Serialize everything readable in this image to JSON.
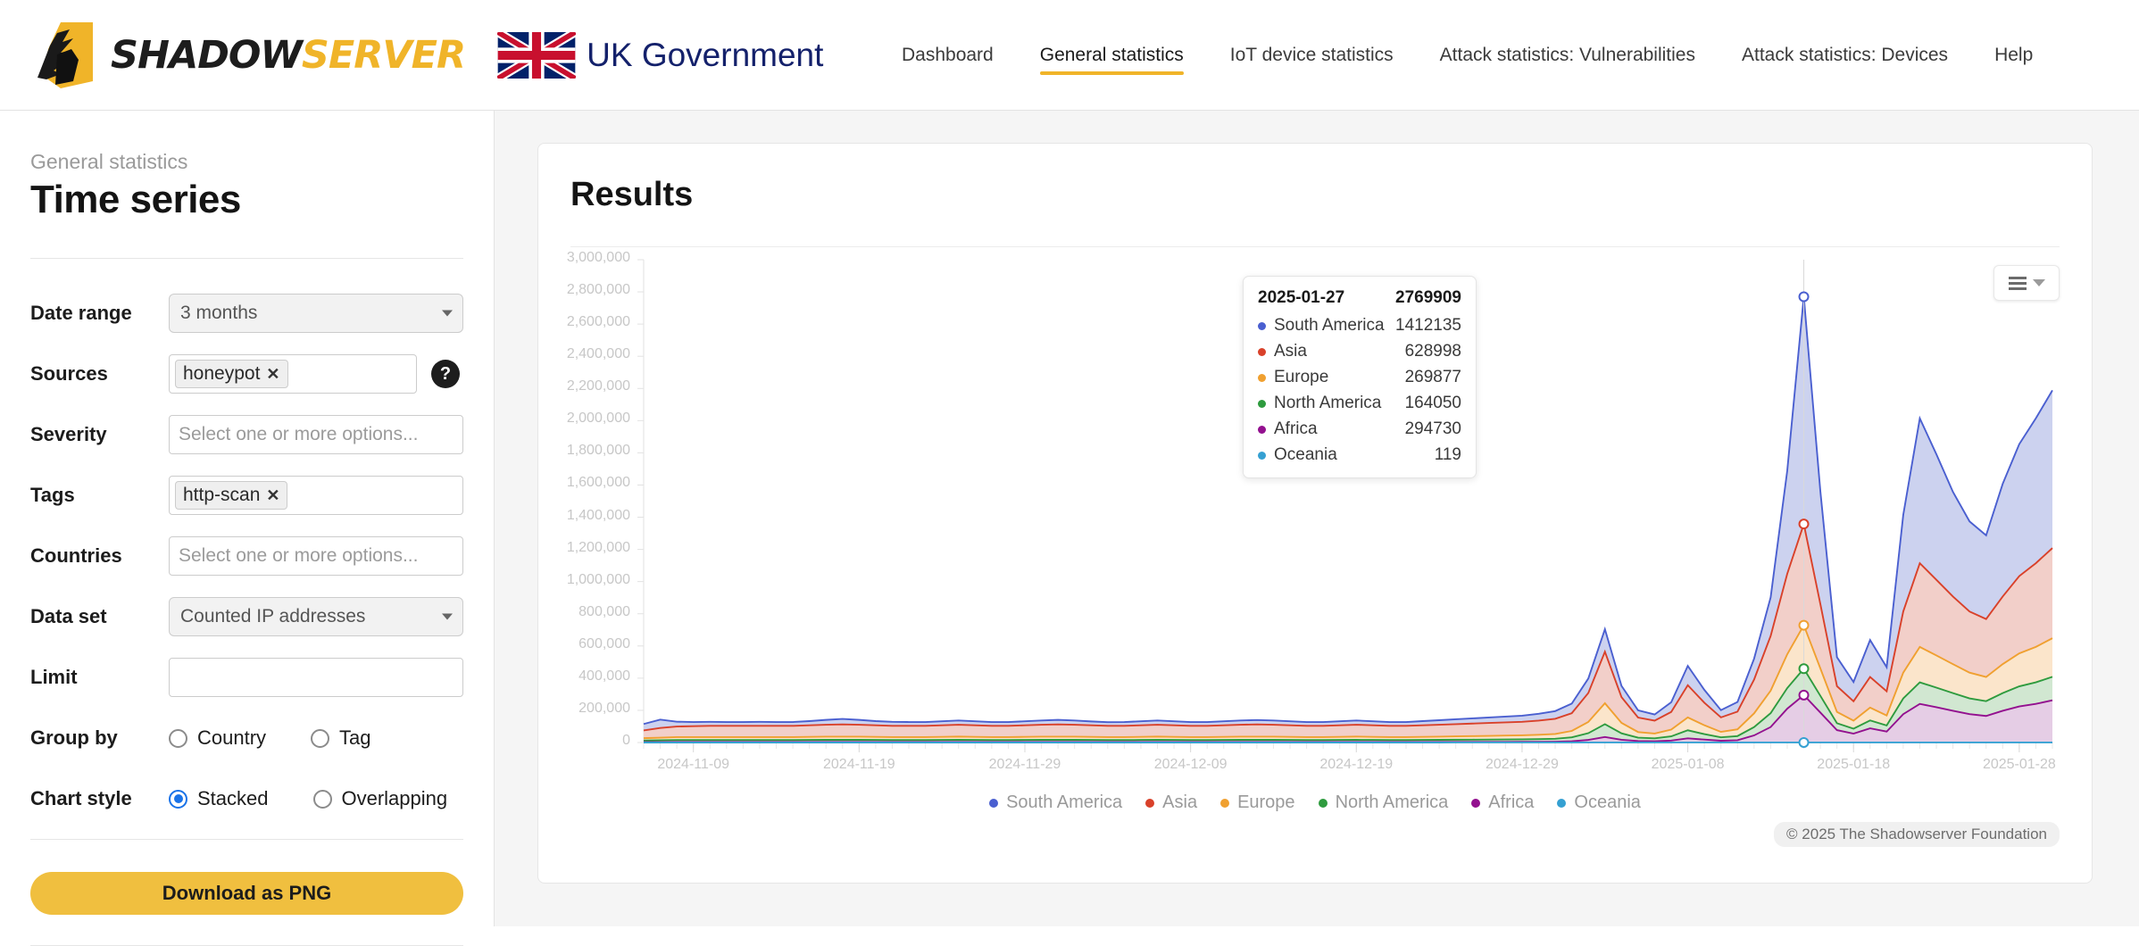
{
  "header": {
    "brand_a": "SHADOW",
    "brand_b": "SERVER",
    "gov_label": "UK Government",
    "nav": [
      {
        "label": "Dashboard",
        "active": false
      },
      {
        "label": "General statistics",
        "active": true
      },
      {
        "label": "IoT device statistics",
        "active": false
      },
      {
        "label": "Attack statistics: Vulnerabilities",
        "active": false
      },
      {
        "label": "Attack statistics: Devices",
        "active": false
      },
      {
        "label": "Help",
        "active": false
      }
    ]
  },
  "sidebar": {
    "kicker": "General statistics",
    "title": "Time series",
    "fields": {
      "date_range": {
        "label": "Date range",
        "value": "3 months"
      },
      "sources": {
        "label": "Sources",
        "tokens": [
          "honeypot"
        ],
        "help": "?"
      },
      "severity": {
        "label": "Severity",
        "placeholder": "Select one or more options..."
      },
      "tags": {
        "label": "Tags",
        "tokens": [
          "http-scan"
        ]
      },
      "countries": {
        "label": "Countries",
        "placeholder": "Select one or more options..."
      },
      "data_set": {
        "label": "Data set",
        "value": "Counted IP addresses"
      },
      "limit": {
        "label": "Limit",
        "value": ""
      },
      "group_by": {
        "label": "Group by",
        "options": [
          {
            "label": "Country",
            "checked": false
          },
          {
            "label": "Tag",
            "checked": false
          }
        ]
      },
      "chart_style": {
        "label": "Chart style",
        "options": [
          {
            "label": "Stacked",
            "checked": true
          },
          {
            "label": "Overlapping",
            "checked": false
          }
        ]
      }
    },
    "download_button": "Download as PNG"
  },
  "main": {
    "card_title": "Results",
    "menu_button": "chart-menu",
    "copyright": "© 2025 The Shadowserver Foundation"
  },
  "tooltip": {
    "date": "2025-01-27",
    "total": "2769909",
    "rows": [
      {
        "name": "South America",
        "value": "1412135",
        "color": "#4a5fd0"
      },
      {
        "name": "Asia",
        "value": "628998",
        "color": "#d9412a"
      },
      {
        "name": "Europe",
        "value": "269877",
        "color": "#f0a030"
      },
      {
        "name": "North America",
        "value": "164050",
        "color": "#2e9b3e"
      },
      {
        "name": "Africa",
        "value": "294730",
        "color": "#93108f"
      },
      {
        "name": "Oceania",
        "value": "119",
        "color": "#35a0d2"
      }
    ]
  },
  "chart_data": {
    "type": "area",
    "stacked": true,
    "title": "Results",
    "xlabel": "",
    "ylabel": "",
    "ylim": [
      0,
      3000000
    ],
    "grid": true,
    "legend_position": "bottom",
    "ytick_labels": [
      "3,000,000",
      "2,800,000",
      "2,600,000",
      "2,400,000",
      "2,200,000",
      "2,000,000",
      "1,800,000",
      "1,600,000",
      "1,400,000",
      "1,200,000",
      "1,000,000",
      "800,000",
      "600,000",
      "400,000",
      "200,000",
      "0"
    ],
    "ytick_values": [
      3000000,
      2800000,
      2600000,
      2400000,
      2200000,
      2000000,
      1800000,
      1600000,
      1400000,
      1200000,
      1000000,
      800000,
      600000,
      400000,
      200000,
      0
    ],
    "xtick_labels": [
      "2024-11-09",
      "2024-11-19",
      "2024-11-29",
      "2024-12-09",
      "2024-12-19",
      "2024-12-29",
      "2025-01-08",
      "2025-01-18",
      "2025-01-28"
    ],
    "x_start": "2024-11-06",
    "x_end": "2025-02-04",
    "highlight_x": "2025-01-27",
    "series": [
      {
        "name": "South America",
        "color": "#4a5fd0",
        "fill": "#c9d0ee",
        "values": [
          40000,
          52000,
          30000,
          26000,
          25000,
          24000,
          24000,
          25000,
          24000,
          24000,
          26000,
          30000,
          34000,
          30000,
          26000,
          25000,
          24000,
          24000,
          25000,
          26000,
          25000,
          24000,
          24000,
          25000,
          26000,
          28000,
          26000,
          24000,
          23000,
          24000,
          25000,
          26000,
          25000,
          24000,
          24000,
          25000,
          26000,
          27000,
          26000,
          25000,
          24000,
          24000,
          25000,
          26000,
          25000,
          24000,
          24000,
          26000,
          28000,
          30000,
          32000,
          34000,
          36000,
          38000,
          42000,
          48000,
          60000,
          90000,
          140000,
          70000,
          45000,
          38000,
          60000,
          120000,
          80000,
          45000,
          60000,
          130000,
          240000,
          640000,
          1412135,
          700000,
          180000,
          120000,
          230000,
          150000,
          600000,
          900000,
          780000,
          650000,
          560000,
          520000,
          700000,
          820000,
          900000,
          980000
        ]
      },
      {
        "name": "Asia",
        "color": "#d9412a",
        "fill": "#f3cfc6",
        "values": [
          48000,
          60000,
          66000,
          68000,
          70000,
          70000,
          70000,
          70000,
          70000,
          70000,
          72000,
          74000,
          76000,
          74000,
          72000,
          70000,
          70000,
          70000,
          72000,
          74000,
          72000,
          70000,
          70000,
          72000,
          74000,
          76000,
          74000,
          72000,
          70000,
          70000,
          72000,
          74000,
          72000,
          70000,
          70000,
          72000,
          74000,
          76000,
          74000,
          72000,
          70000,
          70000,
          72000,
          74000,
          72000,
          70000,
          70000,
          72000,
          74000,
          76000,
          78000,
          80000,
          82000,
          84000,
          88000,
          94000,
          110000,
          180000,
          320000,
          160000,
          90000,
          80000,
          110000,
          200000,
          140000,
          90000,
          110000,
          210000,
          340000,
          500000,
          628998,
          400000,
          160000,
          120000,
          190000,
          150000,
          380000,
          520000,
          470000,
          420000,
          380000,
          360000,
          420000,
          480000,
          520000,
          560000
        ]
      },
      {
        "name": "Europe",
        "color": "#f0a030",
        "fill": "#fbe6cb",
        "values": [
          14000,
          16000,
          18000,
          18000,
          18000,
          18000,
          18000,
          18000,
          18000,
          18000,
          19000,
          20000,
          20000,
          20000,
          19000,
          18000,
          18000,
          18000,
          19000,
          20000,
          19000,
          18000,
          18000,
          19000,
          20000,
          20000,
          20000,
          19000,
          18000,
          18000,
          19000,
          20000,
          19000,
          18000,
          18000,
          19000,
          20000,
          20000,
          20000,
          19000,
          18000,
          18000,
          19000,
          20000,
          19000,
          18000,
          18000,
          19000,
          20000,
          21000,
          22000,
          23000,
          24000,
          25000,
          27000,
          30000,
          40000,
          70000,
          130000,
          65000,
          35000,
          30000,
          42000,
          80000,
          55000,
          34000,
          42000,
          85000,
          140000,
          210000,
          269877,
          170000,
          70000,
          50000,
          80000,
          62000,
          160000,
          220000,
          200000,
          180000,
          160000,
          150000,
          180000,
          205000,
          220000,
          240000
        ]
      },
      {
        "name": "North America",
        "color": "#2e9b3e",
        "fill": "#cfe7d1",
        "values": [
          10000,
          11000,
          12000,
          12000,
          12000,
          12000,
          12000,
          12000,
          12000,
          12000,
          12500,
          13000,
          13000,
          13000,
          12500,
          12000,
          12000,
          12000,
          12500,
          13000,
          12500,
          12000,
          12000,
          12500,
          13000,
          13000,
          13000,
          12500,
          12000,
          12000,
          12500,
          13000,
          12500,
          12000,
          12000,
          12500,
          13000,
          13000,
          13000,
          12500,
          12000,
          12000,
          12500,
          13000,
          12500,
          12000,
          12000,
          12500,
          13000,
          13500,
          14000,
          14500,
          15000,
          15500,
          16500,
          18000,
          24000,
          42000,
          80000,
          40000,
          21000,
          18000,
          26000,
          50000,
          34000,
          21000,
          26000,
          52000,
          86000,
          128000,
          164050,
          104000,
          43000,
          31000,
          49000,
          38000,
          98000,
          134000,
          122000,
          110000,
          98000,
          92000,
          110000,
          125000,
          134000,
          146000
        ]
      },
      {
        "name": "Africa",
        "color": "#93108f",
        "fill": "#e6cbe6",
        "values": [
          3000,
          3200,
          3400,
          3400,
          3400,
          3400,
          3400,
          3400,
          3400,
          3400,
          3500,
          3600,
          3600,
          3600,
          3500,
          3400,
          3400,
          3400,
          3500,
          3600,
          3500,
          3400,
          3400,
          3500,
          3600,
          3600,
          3600,
          3500,
          3400,
          3400,
          3500,
          3600,
          3500,
          3400,
          3400,
          3500,
          3600,
          3600,
          3600,
          3500,
          3400,
          3400,
          3500,
          3600,
          3500,
          3400,
          3400,
          3500,
          3600,
          3700,
          3800,
          3900,
          4000,
          4200,
          4600,
          5200,
          8000,
          16000,
          34000,
          17000,
          9000,
          8000,
          12000,
          26000,
          18000,
          11000,
          14000,
          44000,
          96000,
          210000,
          294730,
          186000,
          77000,
          55000,
          88000,
          68000,
          176000,
          240000,
          219000,
          197000,
          176000,
          165000,
          197000,
          224000,
          240000,
          262000
        ]
      },
      {
        "name": "Oceania",
        "color": "#35a0d2",
        "fill": "#cfe6f2",
        "values": [
          60,
          62,
          64,
          64,
          64,
          64,
          64,
          64,
          64,
          64,
          66,
          68,
          68,
          68,
          66,
          64,
          64,
          64,
          66,
          68,
          66,
          64,
          64,
          66,
          68,
          68,
          68,
          66,
          64,
          64,
          66,
          68,
          66,
          64,
          64,
          66,
          68,
          68,
          68,
          66,
          64,
          64,
          66,
          68,
          66,
          64,
          64,
          66,
          68,
          70,
          72,
          74,
          76,
          78,
          82,
          88,
          94,
          100,
          106,
          100,
          92,
          88,
          94,
          102,
          96,
          90,
          94,
          104,
          110,
          115,
          119,
          112,
          100,
          96,
          104,
          98,
          110,
          116,
          114,
          110,
          106,
          104,
          110,
          114,
          116,
          119
        ]
      }
    ]
  },
  "legend": [
    {
      "label": "South America",
      "color": "#4a5fd0"
    },
    {
      "label": "Asia",
      "color": "#d9412a"
    },
    {
      "label": "Europe",
      "color": "#f0a030"
    },
    {
      "label": "North America",
      "color": "#2e9b3e"
    },
    {
      "label": "Africa",
      "color": "#93108f"
    },
    {
      "label": "Oceania",
      "color": "#35a0d2"
    }
  ]
}
